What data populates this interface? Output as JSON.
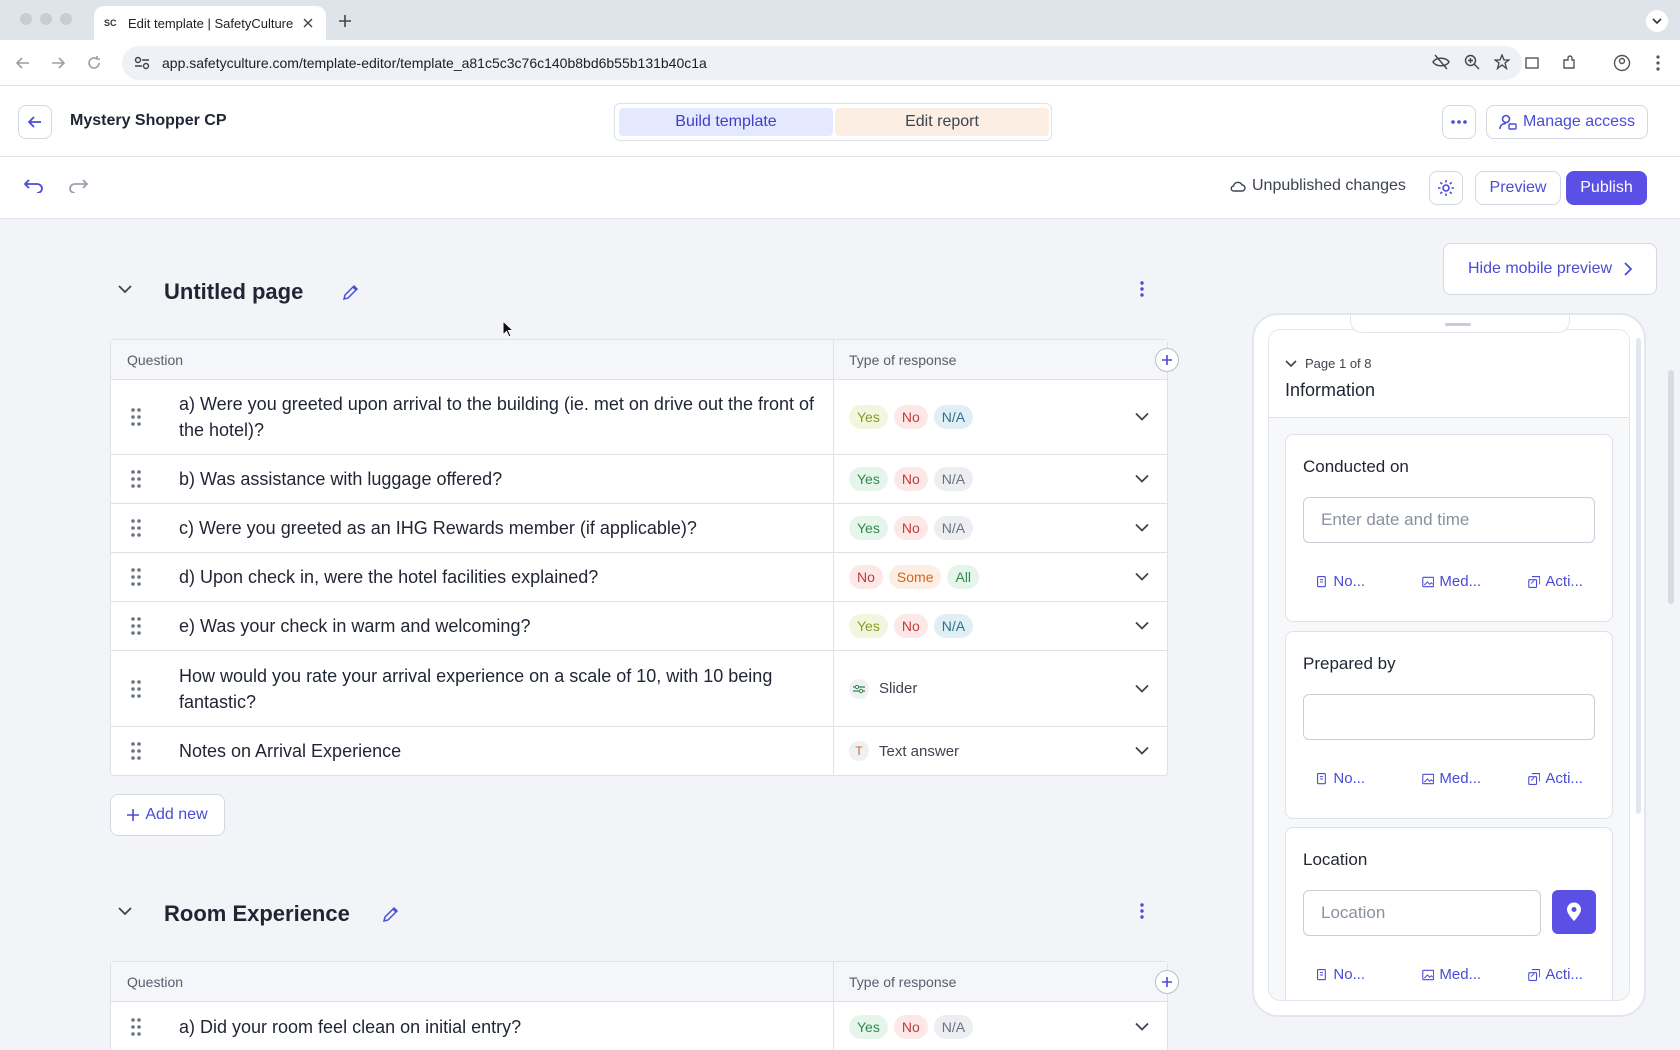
{
  "browser": {
    "tab_title": "Edit template | SafetyCulture",
    "favicon_text": "SC",
    "url": "app.safetyculture.com/template-editor/template_a81c5c3c76c140b8bd6b55b131b40c1a"
  },
  "header": {
    "template_name": "Mystery Shopper CP",
    "mode_active": "Build template",
    "mode_inactive": "Edit report",
    "manage_access": "Manage access"
  },
  "subheader": {
    "status": "Unpublished changes",
    "preview": "Preview",
    "publish": "Publish"
  },
  "table_headers": {
    "question": "Question",
    "response": "Type of response"
  },
  "page1": {
    "title": "Untitled page",
    "rows": [
      {
        "q": "a) Were you greeted upon arrival to the building (ie. met on drive out the front of the hotel)?"
      },
      {
        "q": "b) Was assistance with luggage offered?"
      },
      {
        "q": "c) Were you greeted as an IHG Rewards member (if applicable)?"
      },
      {
        "q": "d) Upon check in, were the hotel facilities explained?"
      },
      {
        "q": "e) Was your check in warm and welcoming?"
      },
      {
        "q": "How would you rate your arrival experience on a scale of 10, with 10 being fantastic?"
      },
      {
        "q": "Notes on Arrival Experience"
      }
    ],
    "responses": {
      "yes": "Yes",
      "no": "No",
      "na": "N/A",
      "some": "Some",
      "all": "All",
      "slider": "Slider",
      "text_answer": "Text answer",
      "text_icon": "T"
    }
  },
  "add_new": "Add new",
  "page2": {
    "title": "Room Experience",
    "rows": [
      {
        "q": "a) Did your room feel clean on initial entry?"
      }
    ]
  },
  "mobile_preview": {
    "hide_label": "Hide mobile preview",
    "page_label": "Page 1 of 8",
    "section": "Information",
    "cards": [
      {
        "label": "Conducted on",
        "placeholder": "Enter date and time"
      },
      {
        "label": "Prepared by",
        "placeholder": ""
      },
      {
        "label": "Location",
        "placeholder": "Location"
      }
    ],
    "actions": {
      "notes": "No...",
      "media": "Med...",
      "action": "Acti..."
    }
  },
  "colors": {
    "accent": "#5b50e6",
    "link": "#4a4bd6",
    "active_tab_bg": "#e4e9ff"
  }
}
